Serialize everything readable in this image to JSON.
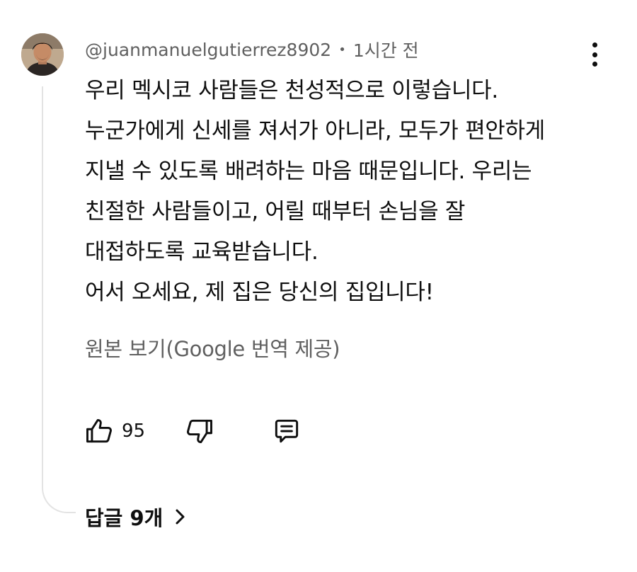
{
  "comment": {
    "author": "@juanmanuelgutierrez8902",
    "separator": "•",
    "timestamp": "1시간 전",
    "lines": [
      "우리 멕시코 사람들은 천성적으로 이렇습니다.",
      "누군가에게 신세를 져서가 아니라, 모두가 편안하게",
      "지낼 수 있도록 배려하는 마음 때문입니다. 우리는",
      "친절한 사람들이고, 어릴 때부터 손님을 잘",
      "대접하도록 교육받습니다.",
      "어서 오세요, 제 집은 당신의 집입니다!"
    ],
    "see_original": "원본 보기(Google 번역 제공)"
  },
  "actions": {
    "like_count": "95"
  },
  "replies": {
    "label": "답글 9개"
  },
  "icons": {
    "avatar": "user-avatar",
    "menu": "more-vert-icon",
    "like": "thumbs-up-icon",
    "dislike": "thumbs-down-icon",
    "reply": "comment-icon",
    "expand": "chevron-right-icon"
  },
  "colors": {
    "text": "#0f0f0f",
    "secondary": "#606060",
    "thread_line": "#e3e3e3"
  }
}
